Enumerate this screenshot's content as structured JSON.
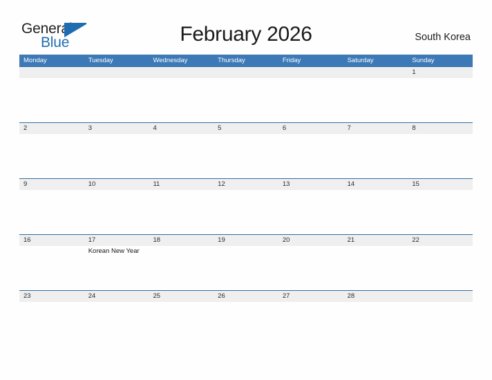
{
  "logo": {
    "word_dark": "General",
    "word_blue": "Blue",
    "triangle_icon": "triangle-right-icon",
    "dark_color": "#231f20",
    "blue_color": "#1f6cb0"
  },
  "header": {
    "title": "February 2026",
    "region": "South Korea",
    "accent_color": "#3c79b6",
    "rule_color": "#2e6da4",
    "date_strip_color": "#efefef"
  },
  "calendar": {
    "day_headers": [
      "Monday",
      "Tuesday",
      "Wednesday",
      "Thursday",
      "Friday",
      "Saturday",
      "Sunday"
    ],
    "weeks": [
      {
        "days": [
          {
            "date": "",
            "events": []
          },
          {
            "date": "",
            "events": []
          },
          {
            "date": "",
            "events": []
          },
          {
            "date": "",
            "events": []
          },
          {
            "date": "",
            "events": []
          },
          {
            "date": "",
            "events": []
          },
          {
            "date": "1",
            "events": []
          }
        ]
      },
      {
        "days": [
          {
            "date": "2",
            "events": []
          },
          {
            "date": "3",
            "events": []
          },
          {
            "date": "4",
            "events": []
          },
          {
            "date": "5",
            "events": []
          },
          {
            "date": "6",
            "events": []
          },
          {
            "date": "7",
            "events": []
          },
          {
            "date": "8",
            "events": []
          }
        ]
      },
      {
        "days": [
          {
            "date": "9",
            "events": []
          },
          {
            "date": "10",
            "events": []
          },
          {
            "date": "11",
            "events": []
          },
          {
            "date": "12",
            "events": []
          },
          {
            "date": "13",
            "events": []
          },
          {
            "date": "14",
            "events": []
          },
          {
            "date": "15",
            "events": []
          }
        ]
      },
      {
        "days": [
          {
            "date": "16",
            "events": []
          },
          {
            "date": "17",
            "events": [
              "Korean New Year"
            ]
          },
          {
            "date": "18",
            "events": []
          },
          {
            "date": "19",
            "events": []
          },
          {
            "date": "20",
            "events": []
          },
          {
            "date": "21",
            "events": []
          },
          {
            "date": "22",
            "events": []
          }
        ]
      },
      {
        "days": [
          {
            "date": "23",
            "events": []
          },
          {
            "date": "24",
            "events": []
          },
          {
            "date": "25",
            "events": []
          },
          {
            "date": "26",
            "events": []
          },
          {
            "date": "27",
            "events": []
          },
          {
            "date": "28",
            "events": []
          },
          {
            "date": "",
            "events": []
          }
        ]
      }
    ]
  }
}
